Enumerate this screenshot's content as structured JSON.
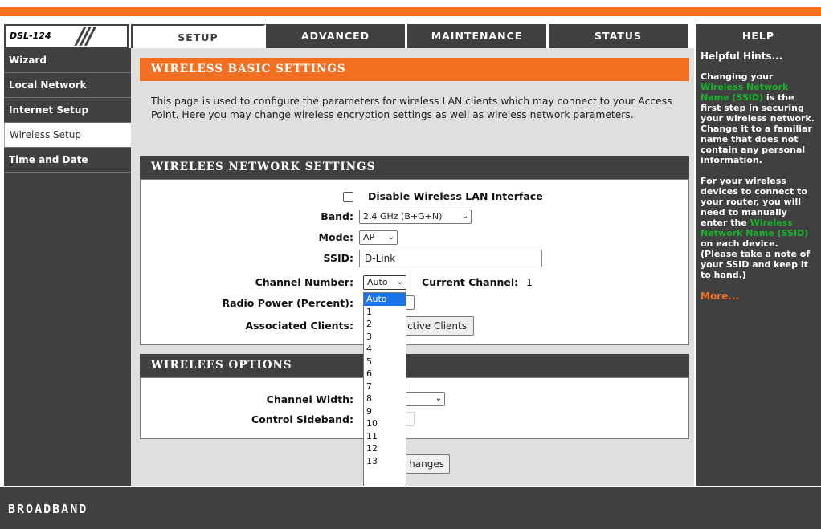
{
  "header": {
    "model": "DSL-124",
    "tabs": [
      "SETUP",
      "ADVANCED",
      "MAINTENANCE",
      "STATUS",
      "HELP"
    ]
  },
  "sidebar": {
    "items": [
      {
        "label": "Wizard"
      },
      {
        "label": "Local Network"
      },
      {
        "label": "Internet Setup"
      },
      {
        "label": "Wireless Setup"
      },
      {
        "label": "Time and Date"
      }
    ]
  },
  "basic": {
    "title": "WIRELESS BASIC SETTINGS",
    "description": "This page is used to configure the parameters for wireless LAN clients which may connect to your Access Point. Here you may change wireless encryption settings as well as wireless network parameters."
  },
  "network": {
    "title": "WIRELEES NETWORK SETTINGS",
    "disable_label": "Disable Wireless LAN Interface",
    "band_label": "Band:",
    "band_value": "2.4 GHz (B+G+N)",
    "mode_label": "Mode:",
    "mode_value": "AP",
    "ssid_label": "SSID:",
    "ssid_value": "D-Link",
    "channel_label": "Channel Number:",
    "channel_value": "Auto",
    "current_channel_label": "Current Channel:",
    "current_channel_value": "1",
    "radio_power_label": "Radio Power (Percent):",
    "assoc_label": "Associated Clients:",
    "assoc_button": "ctive Clients"
  },
  "options": {
    "title": "WIRELEES OPTIONS",
    "width_label": "Channel Width:",
    "sideband_label": "Control Sideband:",
    "apply_button": "hanges"
  },
  "dropdown": {
    "options": [
      "Auto",
      "1",
      "2",
      "3",
      "4",
      "5",
      "6",
      "7",
      "8",
      "9",
      "10",
      "11",
      "12",
      "13"
    ],
    "selected": "Auto"
  },
  "hints": {
    "title": "Helpful Hints...",
    "p1_a": "Changing your ",
    "p1_hl": "Wireless Network Name (SSID)",
    "p1_b": " is the first step in securing your wireless network. Change it to a familiar name that does not contain any personal information.",
    "p2_a": "For your wireless devices to connect to your router, you will need to manually enter the ",
    "p2_hl": "Wireless Network Name (SSID)",
    "p2_b": " on each device. (Please take a note of your SSID and keep it to hand.)",
    "more": "More..."
  },
  "footer": {
    "brand": "BROADBAND"
  },
  "colors": {
    "accent": "#f26f21",
    "dark": "#404040",
    "hint_highlight": "#19b32b"
  }
}
